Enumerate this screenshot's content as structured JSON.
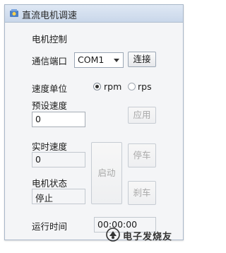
{
  "window": {
    "title": "直流电机调速"
  },
  "motor_control": {
    "section_label": "电机控制",
    "port_label": "通信端口",
    "port_value": "COM1",
    "connect_label": "连接"
  },
  "speed_unit": {
    "label": "速度单位",
    "options": [
      {
        "label": "rpm",
        "checked": true
      },
      {
        "label": "rps",
        "checked": false
      }
    ]
  },
  "preset_speed": {
    "label": "预设速度",
    "value": "0",
    "apply_label": "应用"
  },
  "realtime_speed": {
    "label": "实时速度",
    "value": "0"
  },
  "motor_status": {
    "label": "电机状态",
    "value": "停止"
  },
  "buttons": {
    "start": "启动",
    "stop": "停车",
    "brake": "刹车"
  },
  "run_time": {
    "label": "运行时间",
    "value": "00:00:00"
  },
  "watermark": {
    "text": "电子发烧友"
  }
}
